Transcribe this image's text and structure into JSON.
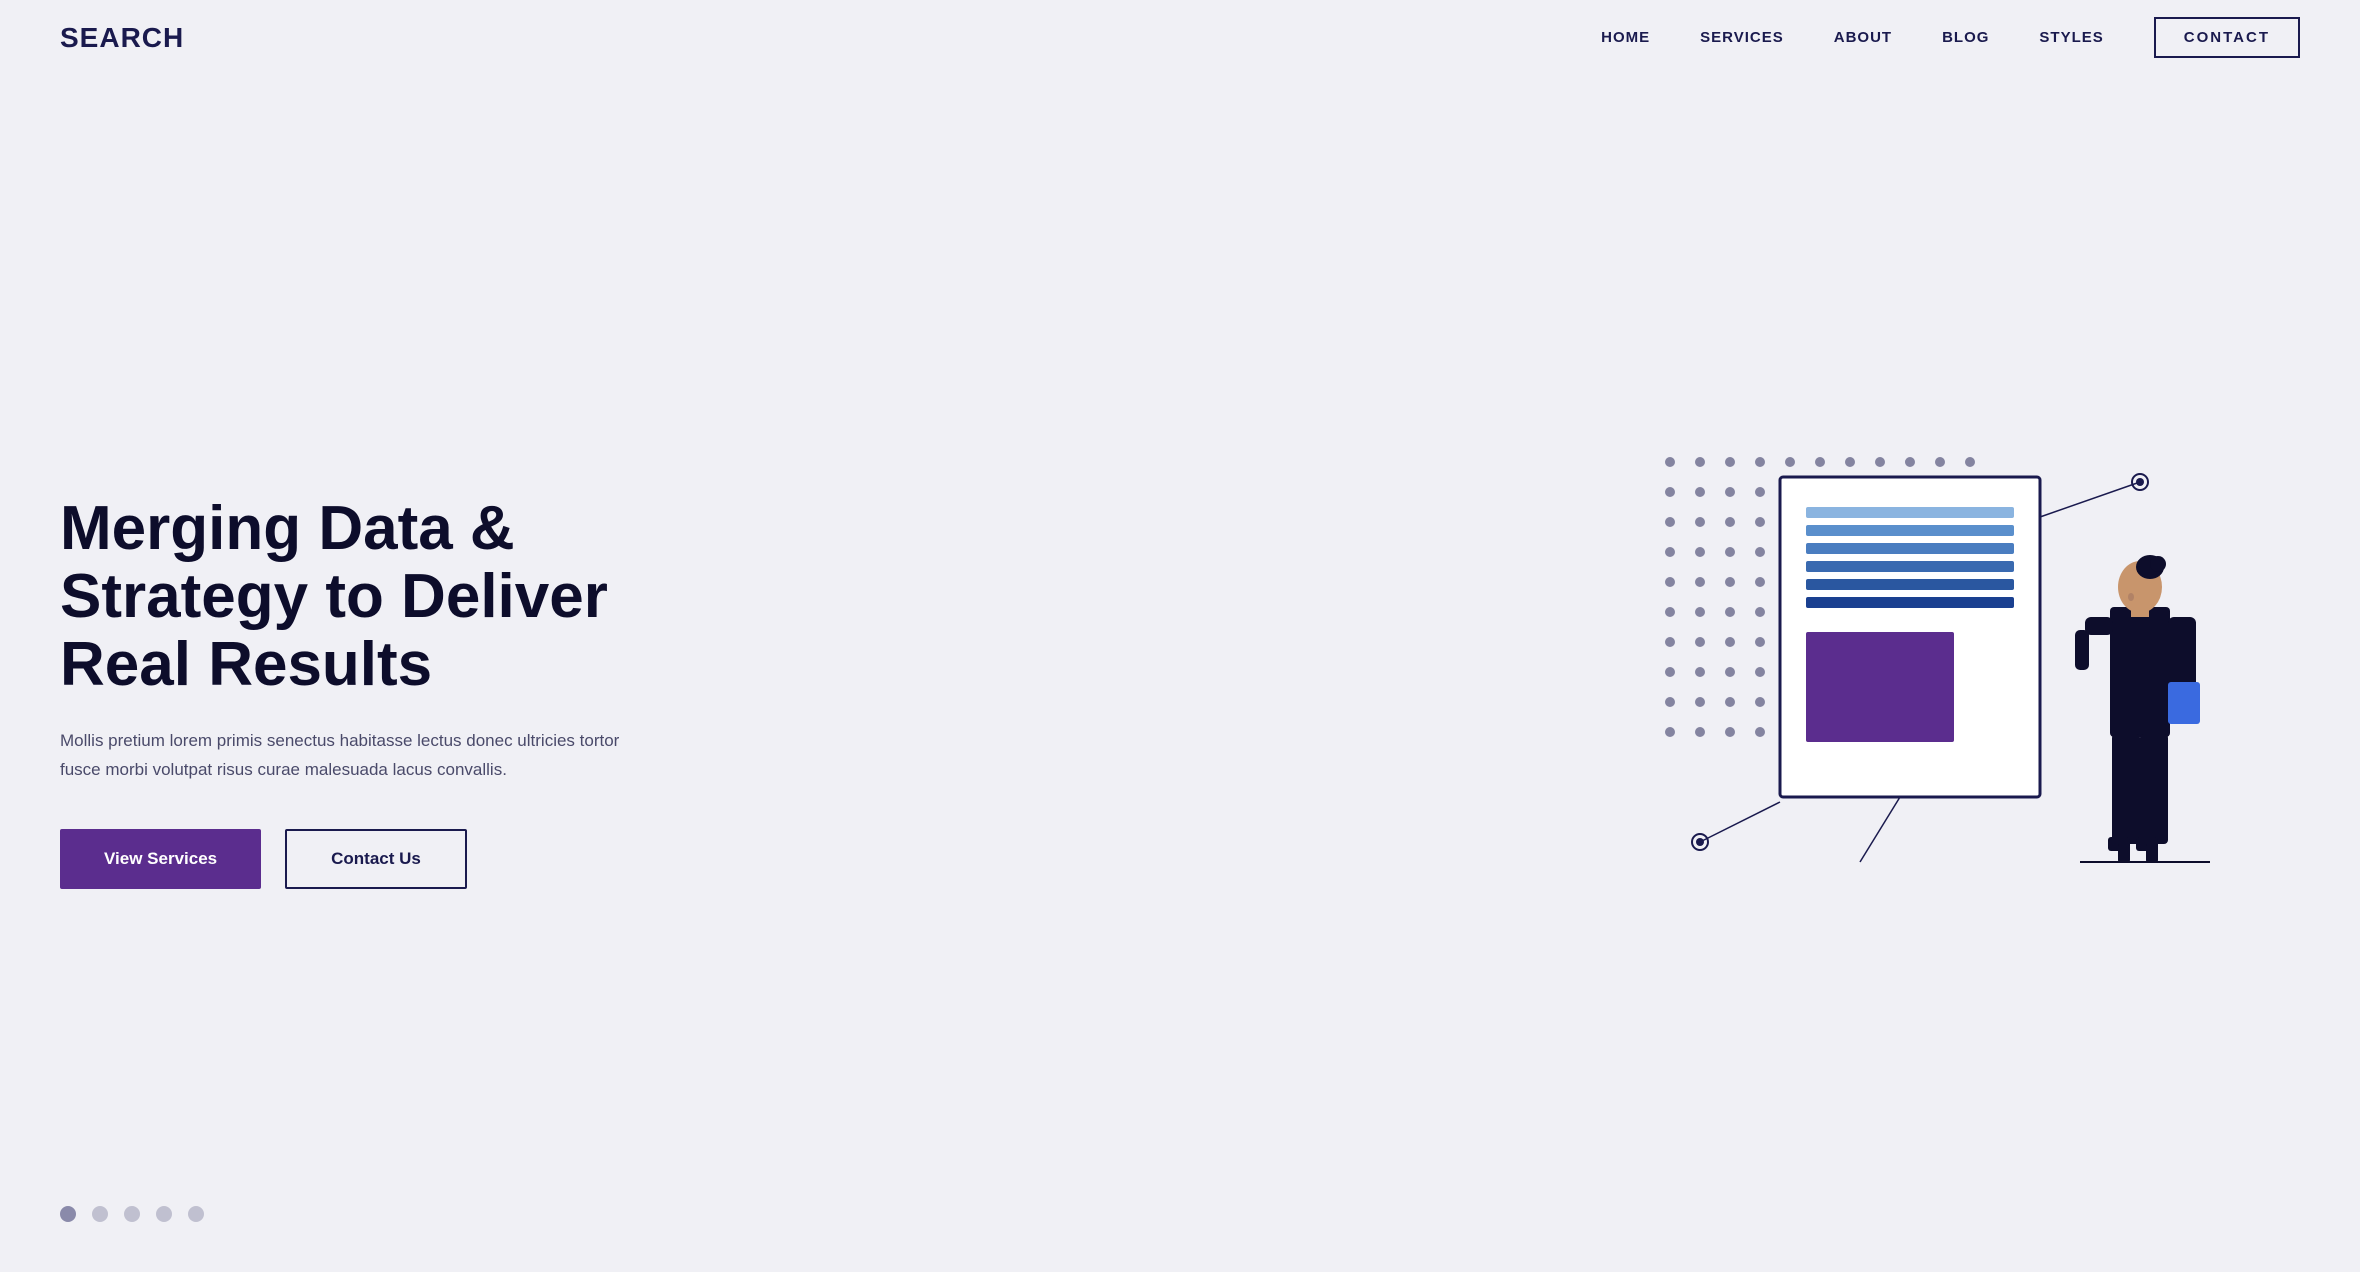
{
  "brand": {
    "logo": "SEARCH"
  },
  "nav": {
    "links": [
      {
        "id": "home",
        "label": "HOME"
      },
      {
        "id": "services",
        "label": "SERVICES"
      },
      {
        "id": "about",
        "label": "ABOUT"
      },
      {
        "id": "blog",
        "label": "BLOG"
      },
      {
        "id": "styles",
        "label": "STYLES"
      },
      {
        "id": "contact",
        "label": "CONTACT"
      }
    ]
  },
  "hero": {
    "title": "Merging Data & Strategy to Deliver Real Results",
    "description": "Mollis pretium lorem primis senectus habitasse lectus donec ultricies tortor fusce morbi volutpat risus curae malesuada lacus convallis.",
    "btn_primary": "View Services",
    "btn_secondary": "Contact Us"
  },
  "bottom_dots": {
    "count": 5,
    "active_index": 0
  },
  "colors": {
    "background": "#f0f0f5",
    "brand_dark": "#1a1a4e",
    "accent_purple": "#5b2d8e",
    "text_body": "#4a4a6a",
    "dot_line_blue": "#6a9fd8",
    "doc_block_purple": "#5b2d8e"
  }
}
